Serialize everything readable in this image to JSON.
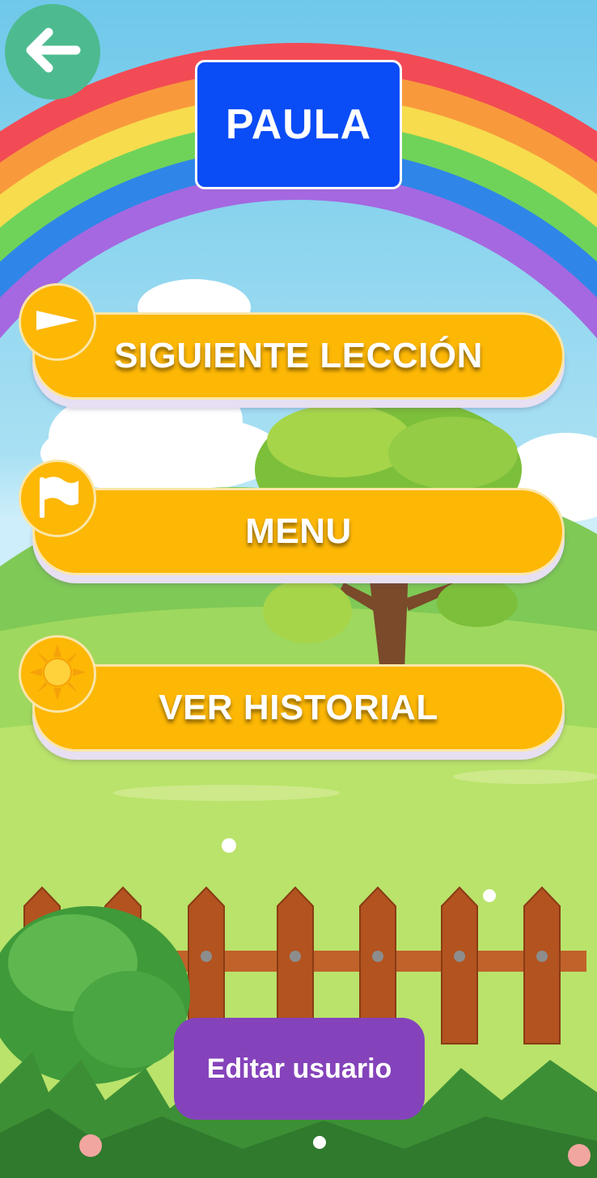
{
  "header": {
    "back_icon": "arrow-left-icon",
    "username": "PAULA",
    "username_bg": "#0a4cf5"
  },
  "menu": {
    "items": [
      {
        "label": "SIGUIENTE LECCIÓN",
        "icon": "play-triangle-icon"
      },
      {
        "label": "MENU",
        "icon": "flag-icon"
      },
      {
        "label": "VER HISTORIAL",
        "icon": "sun-icon"
      }
    ],
    "button_color": "#fdb705"
  },
  "footer": {
    "edit_user_label": "Editar usuario",
    "edit_user_color": "#8543bb"
  }
}
